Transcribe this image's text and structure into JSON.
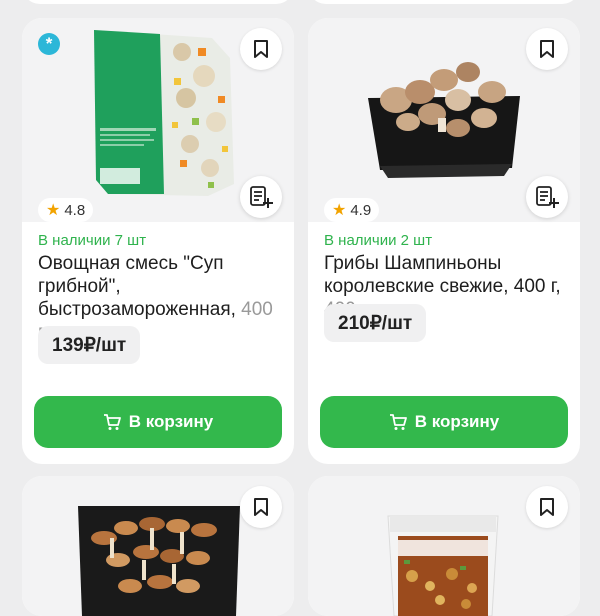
{
  "products": [
    {
      "stock": "В наличии 7 шт",
      "title": "Овощная смесь \"Суп грибной\", быстрозамороженная,",
      "weight": "400 г",
      "price": "139₽/шт",
      "rating": "4.8",
      "cart_label": "В корзину",
      "frozen_badge": "*"
    },
    {
      "stock": "В наличии 2 шт",
      "title": "Грибы Шампиньоны королевские свежие, 400 г,",
      "weight": "400 г",
      "price": "210₽/шт",
      "rating": "4.9",
      "cart_label": "В корзину"
    }
  ],
  "icons": {
    "bookmark": "bookmark-icon",
    "add_to_list": "add-to-list-icon",
    "cart": "cart-icon",
    "star": "star-icon"
  },
  "colors": {
    "accent_green": "#33b84c",
    "stock_green": "#2fb34d",
    "frozen_blue": "#2cb7d8",
    "star_orange": "#f2a300"
  }
}
